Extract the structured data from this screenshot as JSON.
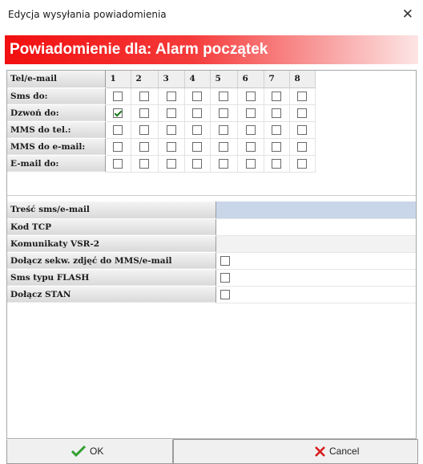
{
  "window": {
    "title": "Edycja wysyłania powiadomienia",
    "close_glyph": "✕"
  },
  "banner": {
    "text": "Powiadomienie dla: Alarm początek",
    "gradient_start": "#f20f0f"
  },
  "grid": {
    "corner": "Tel/e-mail",
    "columns": [
      "1",
      "2",
      "3",
      "4",
      "5",
      "6",
      "7",
      "8"
    ],
    "rows": [
      {
        "label": "Sms do:",
        "checked": [
          false,
          false,
          false,
          false,
          false,
          false,
          false,
          false
        ]
      },
      {
        "label": "Dzwoń do:",
        "checked": [
          true,
          false,
          false,
          false,
          false,
          false,
          false,
          false
        ]
      },
      {
        "label": "MMS do tel.:",
        "checked": [
          false,
          false,
          false,
          false,
          false,
          false,
          false,
          false
        ]
      },
      {
        "label": "MMS do e-mail:",
        "checked": [
          false,
          false,
          false,
          false,
          false,
          false,
          false,
          false
        ]
      },
      {
        "label": "E-mail do:",
        "checked": [
          false,
          false,
          false,
          false,
          false,
          false,
          false,
          false
        ]
      }
    ]
  },
  "properties": [
    {
      "label": "Treść sms/e-mail",
      "kind": "text",
      "value": "",
      "style": "hl"
    },
    {
      "label": "Kod TCP",
      "kind": "text",
      "value": "",
      "style": ""
    },
    {
      "label": "Komunikaty VSR-2",
      "kind": "text",
      "value": "",
      "style": "gray"
    },
    {
      "label": "Dołącz sekw. zdjęć do MMS/e-mail",
      "kind": "checkbox",
      "checked": false
    },
    {
      "label": "Sms typu FLASH",
      "kind": "checkbox",
      "checked": false
    },
    {
      "label": "Dołącz STAN",
      "kind": "checkbox",
      "checked": false
    }
  ],
  "buttons": {
    "ok": {
      "label": "OK",
      "icon": "checkmark-icon",
      "color": "#2fa02f"
    },
    "cancel": {
      "label": "Cancel",
      "icon": "x-icon",
      "color": "#d81b1b"
    }
  }
}
